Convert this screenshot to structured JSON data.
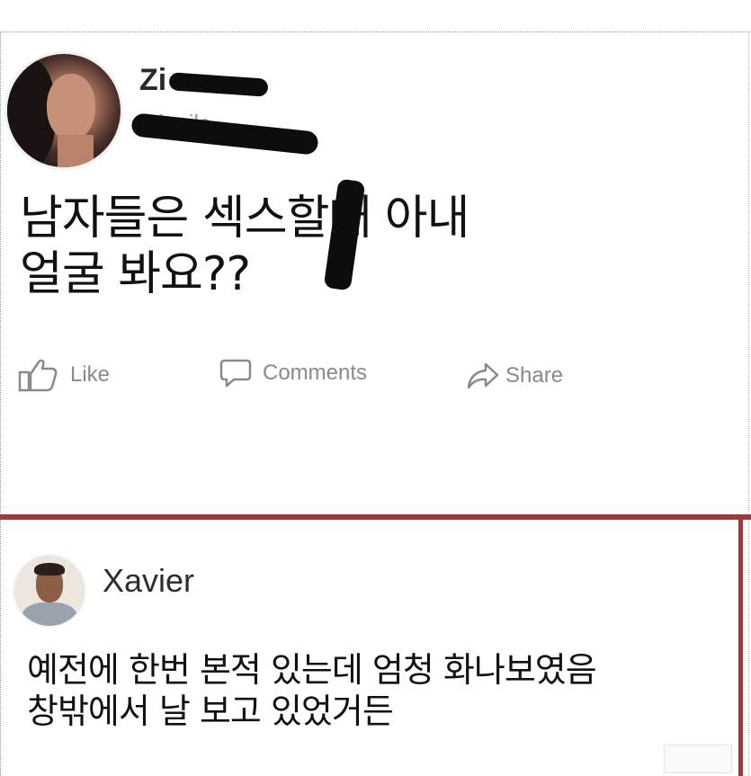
{
  "post": {
    "username": "Zi",
    "handle": "@lt zils",
    "text": "남자들은 섹스할때 아내\n얼굴 봐요??",
    "actions": {
      "like": "Like",
      "comments": "Comments",
      "share": "Share"
    }
  },
  "comment": {
    "author": "Xavier",
    "text": "예전에 한번 본적 있는데 엄청 화나보였음\n창밖에서 날 보고 있었거든"
  },
  "colors": {
    "highlight_border": "#9b3b3b",
    "action_gray": "#8a8a8a"
  },
  "icons": [
    "thumbs-up-icon",
    "speech-bubble-icon",
    "share-arrow-icon"
  ]
}
